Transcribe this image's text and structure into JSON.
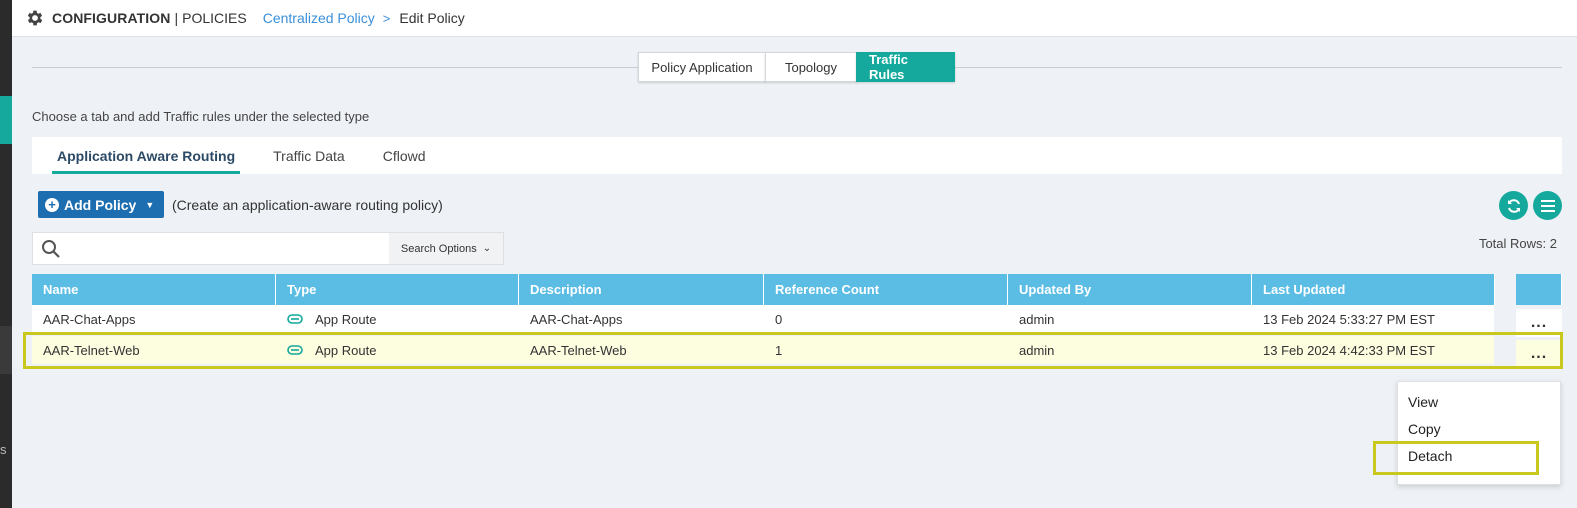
{
  "header": {
    "section": "CONFIGURATION",
    "separator": "|",
    "subsection": "POLICIES",
    "breadcrumb_link": "Centralized Policy",
    "breadcrumb_chevron": ">",
    "breadcrumb_current": "Edit Policy"
  },
  "top_tabs": [
    "Policy Application",
    "Topology",
    "Traffic Rules"
  ],
  "instruction": "Choose a tab and add Traffic rules under the selected type",
  "sub_tabs": [
    "Application Aware Routing",
    "Traffic Data",
    "Cflowd"
  ],
  "toolbar": {
    "add_label": "Add Policy",
    "add_hint": "(Create an application-aware routing policy)"
  },
  "search": {
    "placeholder": "",
    "options_label": "Search Options"
  },
  "total_rows": "Total Rows: 2",
  "table": {
    "headers": [
      "Name",
      "Type",
      "Description",
      "Reference Count",
      "Updated By",
      "Last Updated"
    ],
    "rows": [
      [
        "AAR-Chat-Apps",
        "App Route",
        "AAR-Chat-Apps",
        "0",
        "admin",
        "13 Feb 2024 5:33:27 PM EST"
      ],
      [
        "AAR-Telnet-Web",
        "App Route",
        "AAR-Telnet-Web",
        "1",
        "admin",
        "13 Feb 2024 4:42:33 PM EST"
      ]
    ],
    "actions_label": "..."
  },
  "context_menu": [
    "View",
    "Copy",
    "Detach"
  ],
  "side_fragment": "s",
  "colors": {
    "accent": "#14a99c",
    "primary_button": "#1d6eb1",
    "table_header": "#5bbde4",
    "highlight": "#c8c81e",
    "link": "#3a8fd9"
  }
}
